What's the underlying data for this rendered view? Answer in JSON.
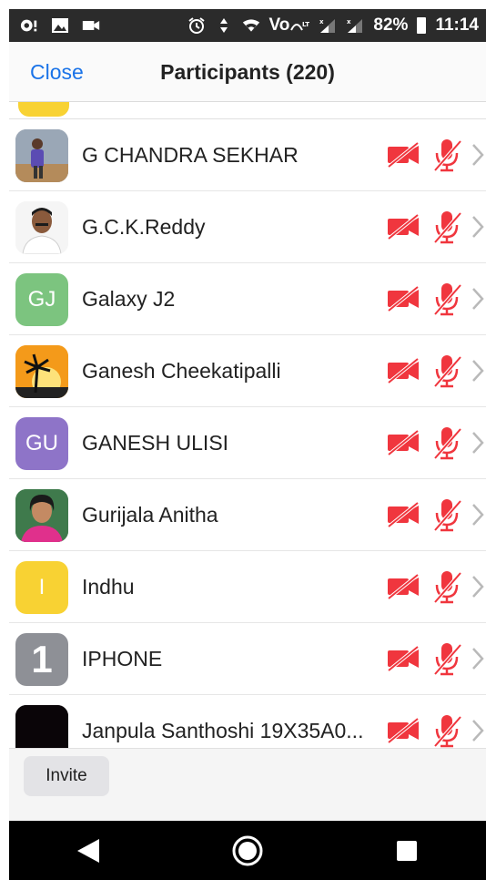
{
  "status_bar": {
    "battery": "82%",
    "time": "11:14",
    "signal_label": "Vo",
    "icons": [
      "notification-icon",
      "gallery-icon",
      "video-icon",
      "alarm-icon",
      "data-arrows-icon",
      "wifi-icon",
      "volte-icon",
      "signal-icon",
      "signal-icon",
      "battery-icon"
    ]
  },
  "header": {
    "close_label": "Close",
    "title": "Participants (220)"
  },
  "participants": [
    {
      "name": "G CHANDRA SEKHAR",
      "avatar_type": "photo",
      "avatar_color": "#7f8a99",
      "initials": ""
    },
    {
      "name": "G.C.K.Reddy",
      "avatar_type": "photo",
      "avatar_color": "#f3f3f3",
      "initials": ""
    },
    {
      "name": "Galaxy J2",
      "avatar_type": "initials",
      "avatar_color": "#7cc47f",
      "initials": "GJ"
    },
    {
      "name": "Ganesh Cheekatipalli",
      "avatar_type": "photo",
      "avatar_color": "#f4a11f",
      "initials": ""
    },
    {
      "name": "GANESH ULISI",
      "avatar_type": "initials",
      "avatar_color": "#8e74c8",
      "initials": "GU"
    },
    {
      "name": "Gurijala Anitha",
      "avatar_type": "photo",
      "avatar_color": "#3a7a46",
      "initials": ""
    },
    {
      "name": "Indhu",
      "avatar_type": "initials",
      "avatar_color": "#f8d233",
      "initials": "I"
    },
    {
      "name": "IPHONE",
      "avatar_type": "initials",
      "avatar_color": "#8e9096",
      "initials": "1"
    },
    {
      "name": "Janpula Santhoshi 19X35A0...",
      "avatar_type": "photo",
      "avatar_color": "#0a0508",
      "initials": ""
    }
  ],
  "row_icons": {
    "camera": "video-off-icon",
    "mic": "mic-muted-icon",
    "chevron": "chevron-right-icon"
  },
  "colors": {
    "muted_red": "#f0363e",
    "link_blue": "#1a73e8",
    "chevron_gray": "#b9b9b9"
  },
  "footer": {
    "invite_label": "Invite"
  },
  "navigation": {
    "icons": [
      "back-icon",
      "home-icon",
      "recents-icon"
    ]
  }
}
